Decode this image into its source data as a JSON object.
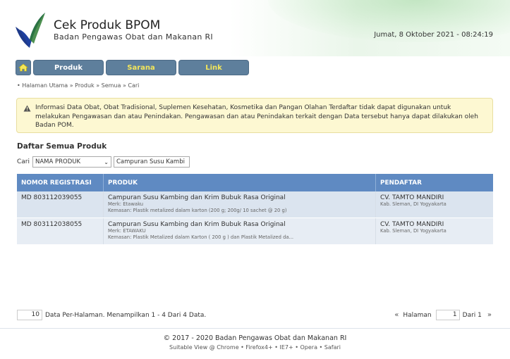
{
  "header": {
    "title": "Cek Produk BPOM",
    "subtitle": "Badan Pengawas Obat dan Makanan RI",
    "datetime": "Jumat, 8 Oktober 2021 - 08:24:19"
  },
  "nav": {
    "home_icon": "home-icon",
    "tabs": [
      {
        "label": "Produk"
      },
      {
        "label": "Sarana"
      },
      {
        "label": "Link"
      }
    ]
  },
  "breadcrumb": "• Halaman Utama » Produk » Semua » Cari",
  "warning": {
    "icon": "warning-icon",
    "text": "Informasi Data Obat, Obat Tradisional, Suplemen Kesehatan, Kosmetika dan Pangan Olahan Terdaftar tidak dapat digunakan untuk melakukan Pengawasan dan atau Penindakan. Pengawasan dan atau Penindakan terkait dengan Data tersebut hanya dapat dilakukan oleh Badan POM."
  },
  "section_title": "Daftar Semua Produk",
  "search": {
    "label": "Cari",
    "select_value": "NAMA PRODUK",
    "input_value": "Campuran Susu Kambi"
  },
  "table": {
    "headers": [
      "NOMOR REGISTRASI",
      "PRODUK",
      "PENDAFTAR"
    ],
    "rows": [
      {
        "reg": "MD 803112039055",
        "product": "Campuran Susu Kambing dan Krim Bubuk Rasa Original",
        "brand": "Merk: Etawaku",
        "pack": "Kemasan: Plastik metalized dalam karton (200 g; 200g/ 10 sachet @ 20 g)",
        "company": "CV. TAMTO MANDIRI",
        "location": "Kab. Sleman, DI Yogyakarta"
      },
      {
        "reg": "MD 803112038055",
        "product": "Campuran Susu Kambing dan Krim Bubuk Rasa Original",
        "brand": "Merk: ETAWAKU",
        "pack": "Kemasan: Plastik Metalized dalam Karton ( 200 g ) dan Plastik Metalized da...",
        "company": "CV. TAMTO MANDIRI",
        "location": "Kab. Sleman, DI Yogyakarta"
      }
    ]
  },
  "pager": {
    "per_page": "10",
    "summary": "Data Per-Halaman. Menampilkan 1 - 4 Dari 4 Data.",
    "prev": "«",
    "page_label": "Halaman",
    "page": "1",
    "of_label": "Dari 1",
    "next": "»"
  },
  "footer": {
    "copyright": "© 2017 - 2020  Badan Pengawas Obat dan Makanan RI",
    "suitable": "Suitable View @ Chrome • Firefox4+ • IE7+ • Opera • Safari"
  }
}
